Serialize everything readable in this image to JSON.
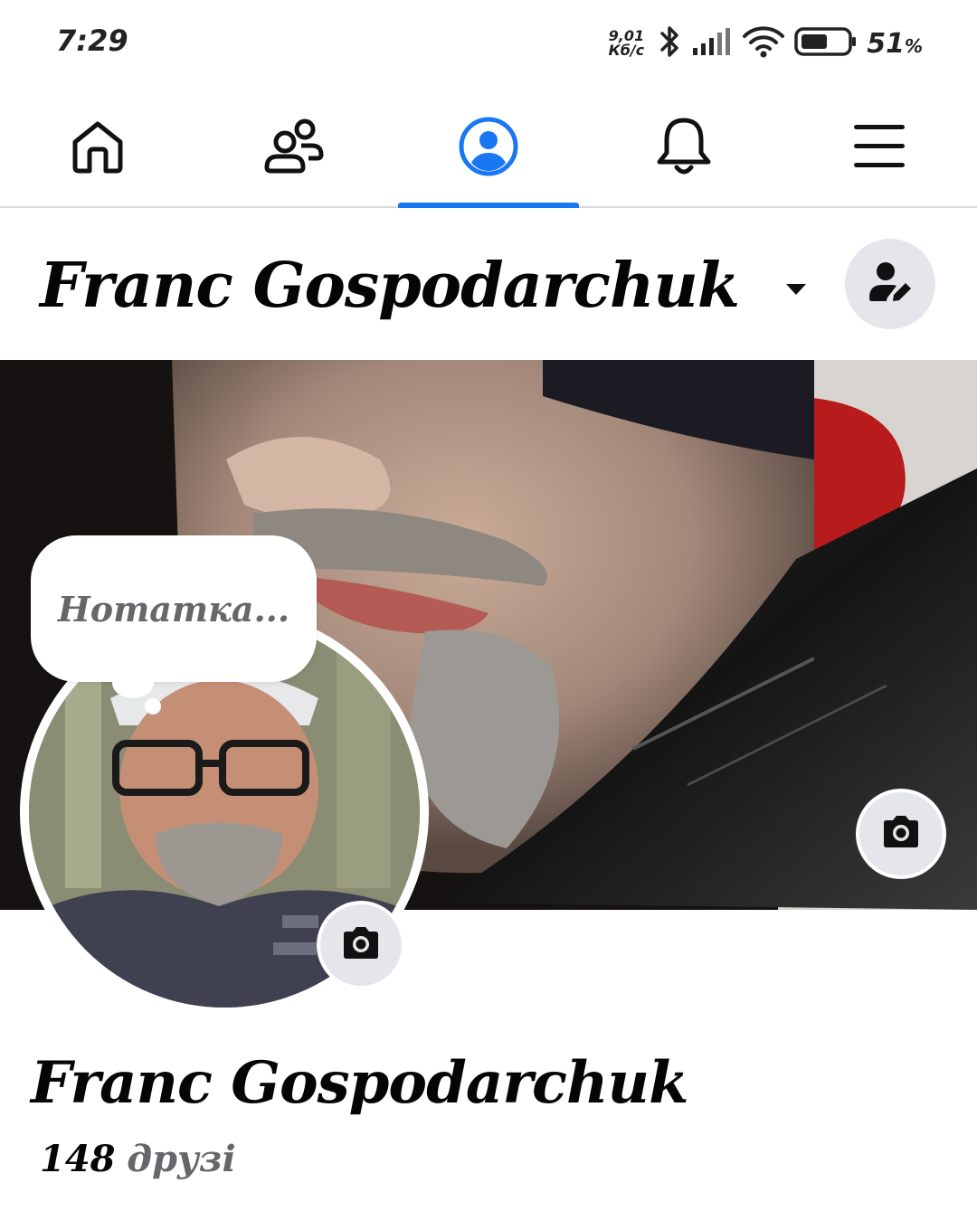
{
  "status_bar": {
    "time": "7:29",
    "net_speed_value": "9,01",
    "net_speed_unit": "Кб/с",
    "battery_percent": "51",
    "battery_percent_sign": "%",
    "icons": [
      "bluetooth-icon",
      "signal-icon",
      "wifi-icon",
      "battery-icon"
    ]
  },
  "nav": {
    "items": [
      {
        "name": "home",
        "icon": "home-icon",
        "active": false
      },
      {
        "name": "friends",
        "icon": "friends-icon",
        "active": false
      },
      {
        "name": "profile",
        "icon": "profile-icon",
        "active": true
      },
      {
        "name": "notifications",
        "icon": "bell-icon",
        "active": false
      },
      {
        "name": "menu",
        "icon": "menu-icon",
        "active": false
      }
    ],
    "active_color": "#1877f2"
  },
  "header": {
    "name": "Franc Gospodarchuk"
  },
  "note": {
    "placeholder": "Нотатка..."
  },
  "profile": {
    "name": "Franc Gospodarchuk",
    "friends_count": "148",
    "friends_label": "друзі"
  }
}
